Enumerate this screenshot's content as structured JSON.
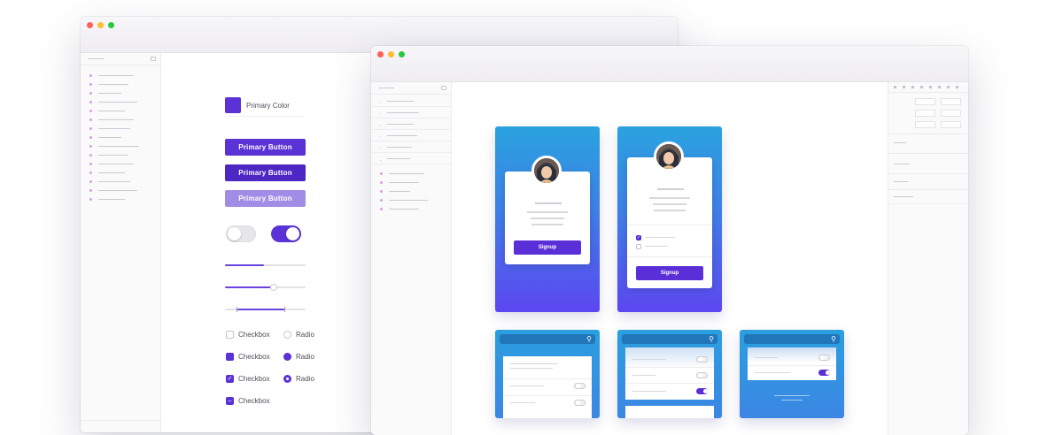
{
  "style_guide_window": {
    "primary_color_label": "Primary Color",
    "buttons": [
      "Primary Button",
      "Primary Button",
      "Primary Button"
    ],
    "toggles": [
      {
        "on": false
      },
      {
        "on": true
      }
    ],
    "sliders": [
      {
        "value": 0.48
      },
      {
        "value": 0.6
      },
      {
        "range": [
          0.15,
          0.73
        ]
      }
    ],
    "checkbox_label": "Checkbox",
    "radio_label": "Radio",
    "checkboxes": [
      {
        "label": "Checkbox",
        "state": "unchecked"
      },
      {
        "label": "Checkbox",
        "state": "filled"
      },
      {
        "label": "Checkbox",
        "state": "checked"
      },
      {
        "label": "Checkbox",
        "state": "indeterminate"
      }
    ],
    "radios": [
      {
        "label": "Radio",
        "state": "unselected"
      },
      {
        "label": "Radio",
        "state": "filled"
      },
      {
        "label": "Radio",
        "state": "selected"
      }
    ]
  },
  "mockup_window": {
    "signup_cards": [
      {
        "button_label": "Signup"
      },
      {
        "button_label": "Signup"
      }
    ],
    "search_icon": "search-icon"
  },
  "colors": {
    "primary": "#5b32d6",
    "primary_dark": "#4d27c4",
    "primary_light": "#a28de6",
    "gradient_top": "#2aa3df",
    "gradient_bottom": "#5b47f0"
  }
}
